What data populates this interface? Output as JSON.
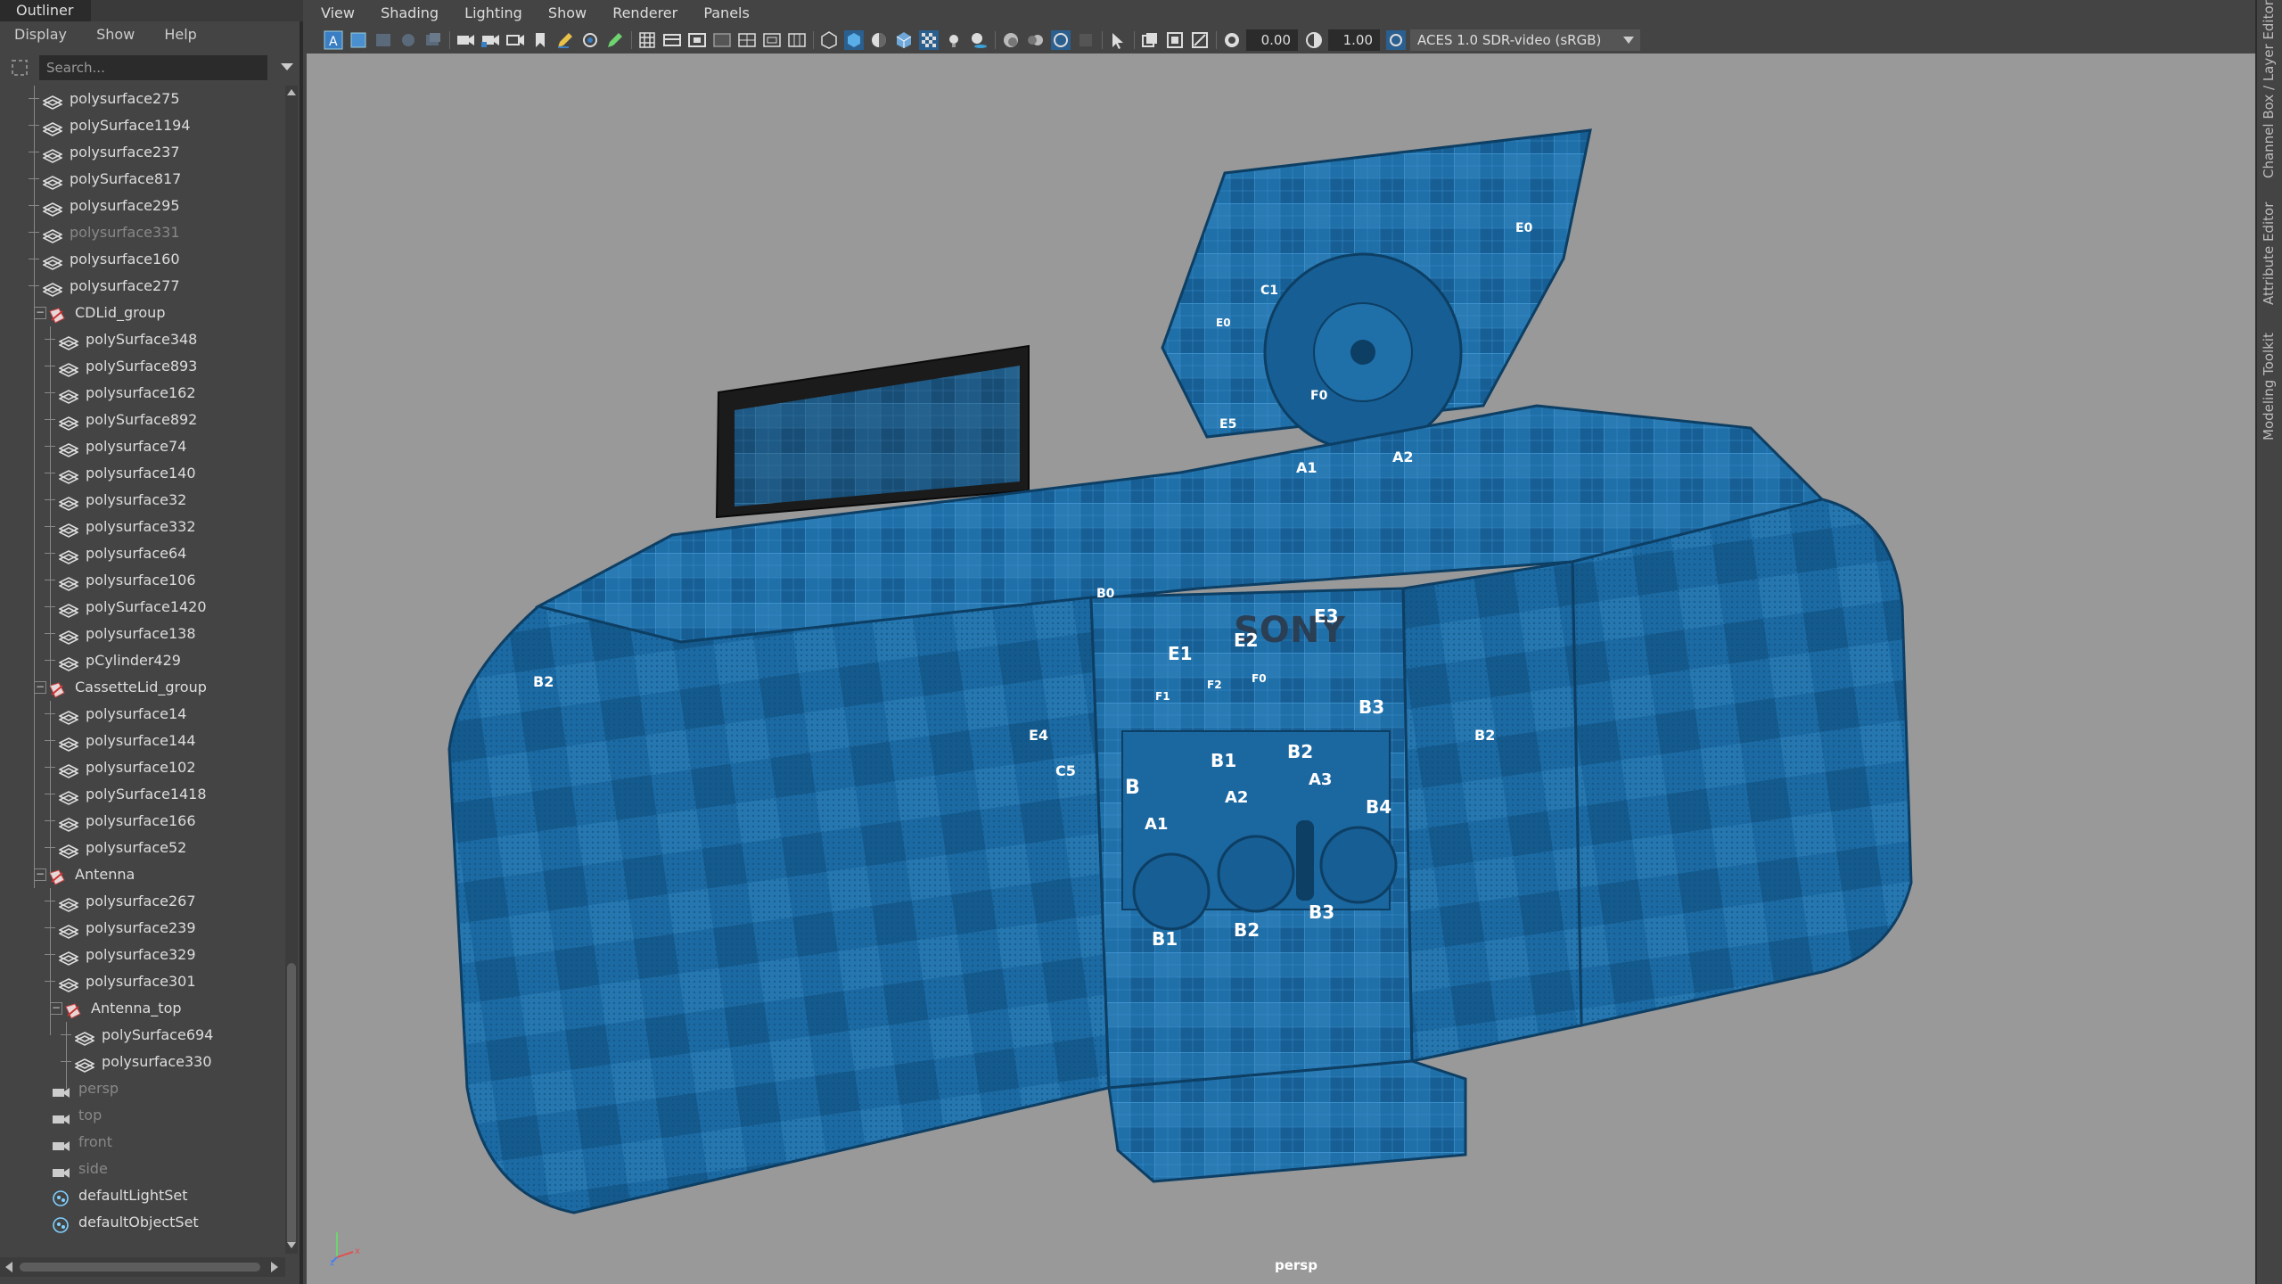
{
  "outliner": {
    "title": "Outliner",
    "menu": [
      "Display",
      "Show",
      "Help"
    ],
    "search_placeholder": "Search...",
    "items": [
      {
        "label": "polysurface275",
        "type": "mesh",
        "depth": 1
      },
      {
        "label": "polySurface1194",
        "type": "mesh",
        "depth": 1
      },
      {
        "label": "polysurface237",
        "type": "mesh",
        "depth": 1
      },
      {
        "label": "polySurface817",
        "type": "mesh",
        "depth": 1
      },
      {
        "label": "polysurface295",
        "type": "mesh",
        "depth": 1
      },
      {
        "label": "polysurface331",
        "type": "mesh",
        "depth": 1,
        "dim": true
      },
      {
        "label": "polysurface160",
        "type": "mesh",
        "depth": 1
      },
      {
        "label": "polysurface277",
        "type": "mesh",
        "depth": 1
      },
      {
        "label": "CDLid_group",
        "type": "group",
        "depth": 1,
        "expanded": true
      },
      {
        "label": "polySurface348",
        "type": "mesh",
        "depth": 2
      },
      {
        "label": "polySurface893",
        "type": "mesh",
        "depth": 2
      },
      {
        "label": "polysurface162",
        "type": "mesh",
        "depth": 2
      },
      {
        "label": "polySurface892",
        "type": "mesh",
        "depth": 2
      },
      {
        "label": "polysurface74",
        "type": "mesh",
        "depth": 2
      },
      {
        "label": "polysurface140",
        "type": "mesh",
        "depth": 2
      },
      {
        "label": "polysurface32",
        "type": "mesh",
        "depth": 2
      },
      {
        "label": "polysurface332",
        "type": "mesh",
        "depth": 2
      },
      {
        "label": "polysurface64",
        "type": "mesh",
        "depth": 2
      },
      {
        "label": "polysurface106",
        "type": "mesh",
        "depth": 2
      },
      {
        "label": "polySurface1420",
        "type": "mesh",
        "depth": 2
      },
      {
        "label": "polysurface138",
        "type": "mesh",
        "depth": 2
      },
      {
        "label": "pCylinder429",
        "type": "mesh",
        "depth": 2
      },
      {
        "label": "CassetteLid_group",
        "type": "group",
        "depth": 1,
        "expanded": true
      },
      {
        "label": "polysurface14",
        "type": "mesh",
        "depth": 2
      },
      {
        "label": "polysurface144",
        "type": "mesh",
        "depth": 2
      },
      {
        "label": "polysurface102",
        "type": "mesh",
        "depth": 2
      },
      {
        "label": "polySurface1418",
        "type": "mesh",
        "depth": 2
      },
      {
        "label": "polysurface166",
        "type": "mesh",
        "depth": 2
      },
      {
        "label": "polysurface52",
        "type": "mesh",
        "depth": 2
      },
      {
        "label": "Antenna",
        "type": "group",
        "depth": 1,
        "expanded": true
      },
      {
        "label": "polysurface267",
        "type": "mesh",
        "depth": 2
      },
      {
        "label": "polysurface239",
        "type": "mesh",
        "depth": 2
      },
      {
        "label": "polysurface329",
        "type": "mesh",
        "depth": 2
      },
      {
        "label": "polysurface301",
        "type": "mesh",
        "depth": 2
      },
      {
        "label": "Antenna_top",
        "type": "group",
        "depth": 2,
        "expanded": true
      },
      {
        "label": "polySurface694",
        "type": "mesh",
        "depth": 3
      },
      {
        "label": "polysurface330",
        "type": "mesh",
        "depth": 3
      },
      {
        "label": "persp",
        "type": "camera",
        "depth": 0,
        "dim": true
      },
      {
        "label": "top",
        "type": "camera",
        "depth": 0,
        "dim": true
      },
      {
        "label": "front",
        "type": "camera",
        "depth": 0,
        "dim": true
      },
      {
        "label": "side",
        "type": "camera",
        "depth": 0,
        "dim": true
      },
      {
        "label": "defaultLightSet",
        "type": "set",
        "depth": 0
      },
      {
        "label": "defaultObjectSet",
        "type": "set",
        "depth": 0
      }
    ]
  },
  "viewport": {
    "menu": [
      "View",
      "Shading",
      "Lighting",
      "Show",
      "Renderer",
      "Panels"
    ],
    "exposure": "0.00",
    "gamma": "1.00",
    "color_management": "ACES 1.0 SDR-video (sRGB)",
    "camera_label": "persp",
    "uv_labels": [
      "SONY",
      "E1",
      "E2",
      "E3",
      "F1",
      "F2",
      "F0",
      "B1",
      "B2",
      "B3",
      "B4",
      "B1",
      "B2",
      "B3",
      "A1",
      "A2",
      "A3",
      "B",
      "E0",
      "C1",
      "E5",
      "B2",
      "B2",
      "C5",
      "E4",
      "F0",
      "A1",
      "A2",
      "B0",
      "E0"
    ],
    "colors": {
      "background": "#999999",
      "mesh": "#1f6fa8",
      "accent": "#1e7fc0"
    }
  },
  "right_tabs": [
    "Channel Box / Layer Editor",
    "Attribute Editor",
    "Modeling Toolkit"
  ]
}
